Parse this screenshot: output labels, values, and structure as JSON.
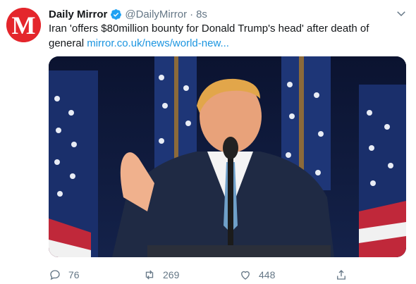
{
  "account": {
    "name": "Daily Mirror",
    "handle": "@DailyMirror",
    "separator": "·",
    "time": "8s",
    "avatar_letter": "M",
    "avatar_color": "#e4262c"
  },
  "tweet": {
    "text": "Iran 'offers $80million bounty for Donald Trump's head' after death of general",
    "link": "mirror.co.uk/news/world-new..."
  },
  "media": {
    "type": "photo",
    "description_icon": "photo-icon"
  },
  "actions": {
    "reply_count": "76",
    "retweet_count": "269",
    "like_count": "448"
  },
  "colors": {
    "link": "#1b95e0",
    "secondary_text": "#657786",
    "verified": "#1da1f2"
  }
}
